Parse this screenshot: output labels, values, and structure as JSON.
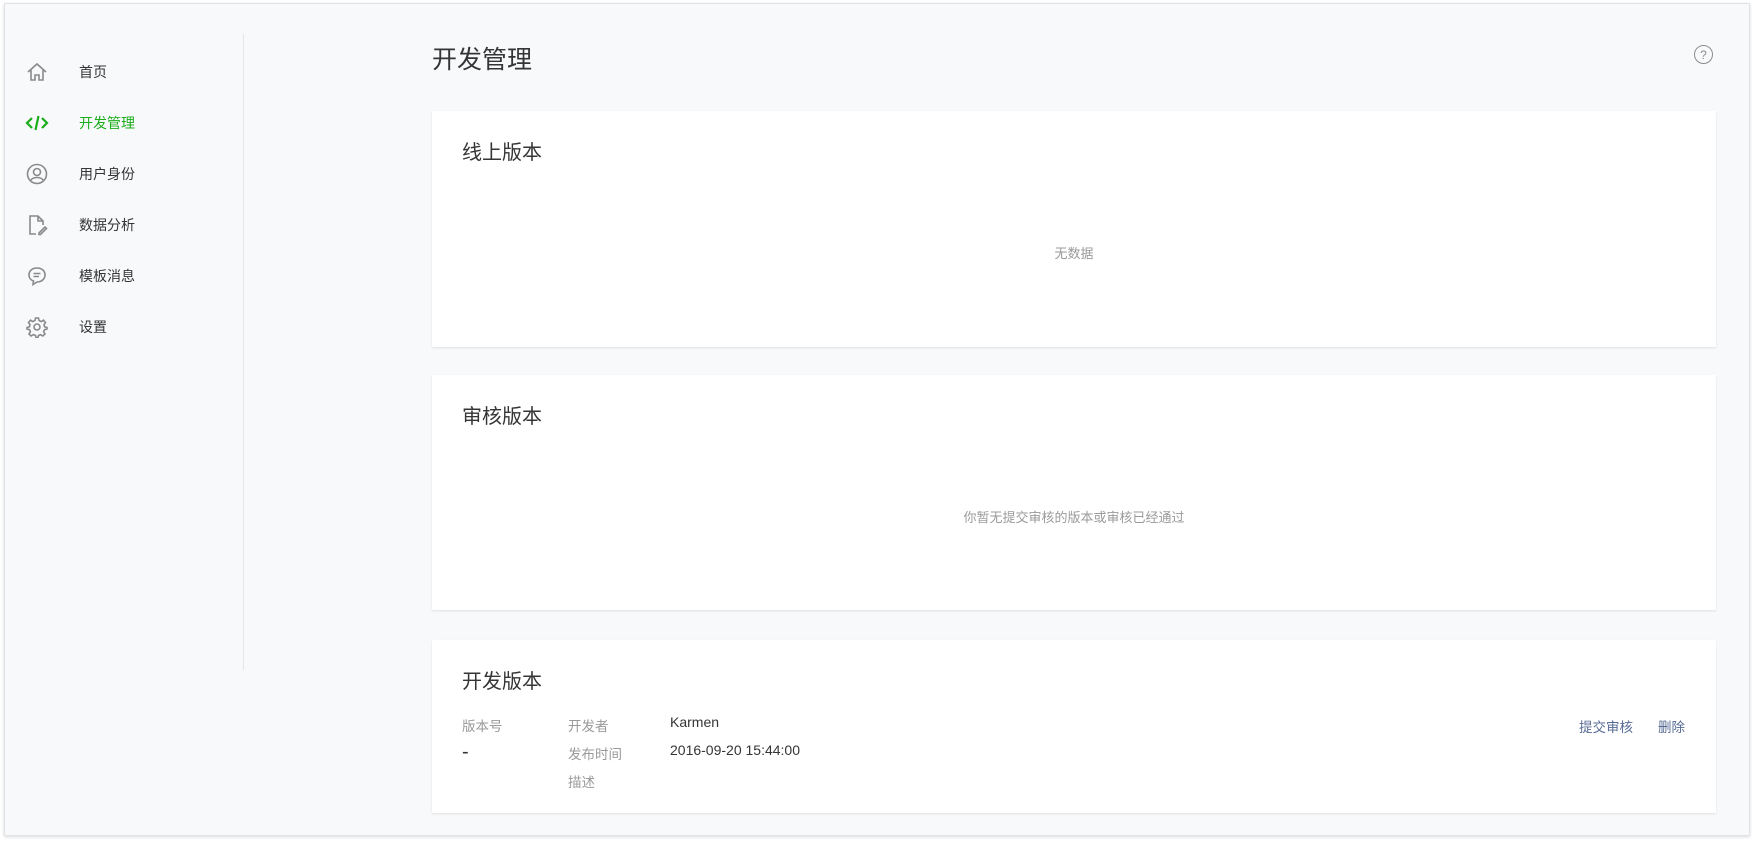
{
  "sidebar": {
    "items": [
      {
        "label": "首页",
        "icon": "home-icon"
      },
      {
        "label": "开发管理",
        "icon": "code-icon",
        "active": true
      },
      {
        "label": "用户身份",
        "icon": "user-icon"
      },
      {
        "label": "数据分析",
        "icon": "document-edit-icon"
      },
      {
        "label": "模板消息",
        "icon": "chat-icon"
      },
      {
        "label": "设置",
        "icon": "gear-icon"
      }
    ]
  },
  "header": {
    "title": "开发管理",
    "help": "?"
  },
  "online": {
    "title": "线上版本",
    "empty": "无数据"
  },
  "review": {
    "title": "审核版本",
    "empty": "你暂无提交审核的版本或审核已经通过"
  },
  "dev": {
    "title": "开发版本",
    "version_label": "版本号",
    "version_value": "-",
    "developer_label": "开发者",
    "developer_value": "Karmen",
    "time_label": "发布时间",
    "time_value": "2016-09-20 15:44:00",
    "desc_label": "描述",
    "submit": "提交审核",
    "delete": "删除"
  },
  "colors": {
    "accent": "#1aad19",
    "link": "#576b95"
  }
}
